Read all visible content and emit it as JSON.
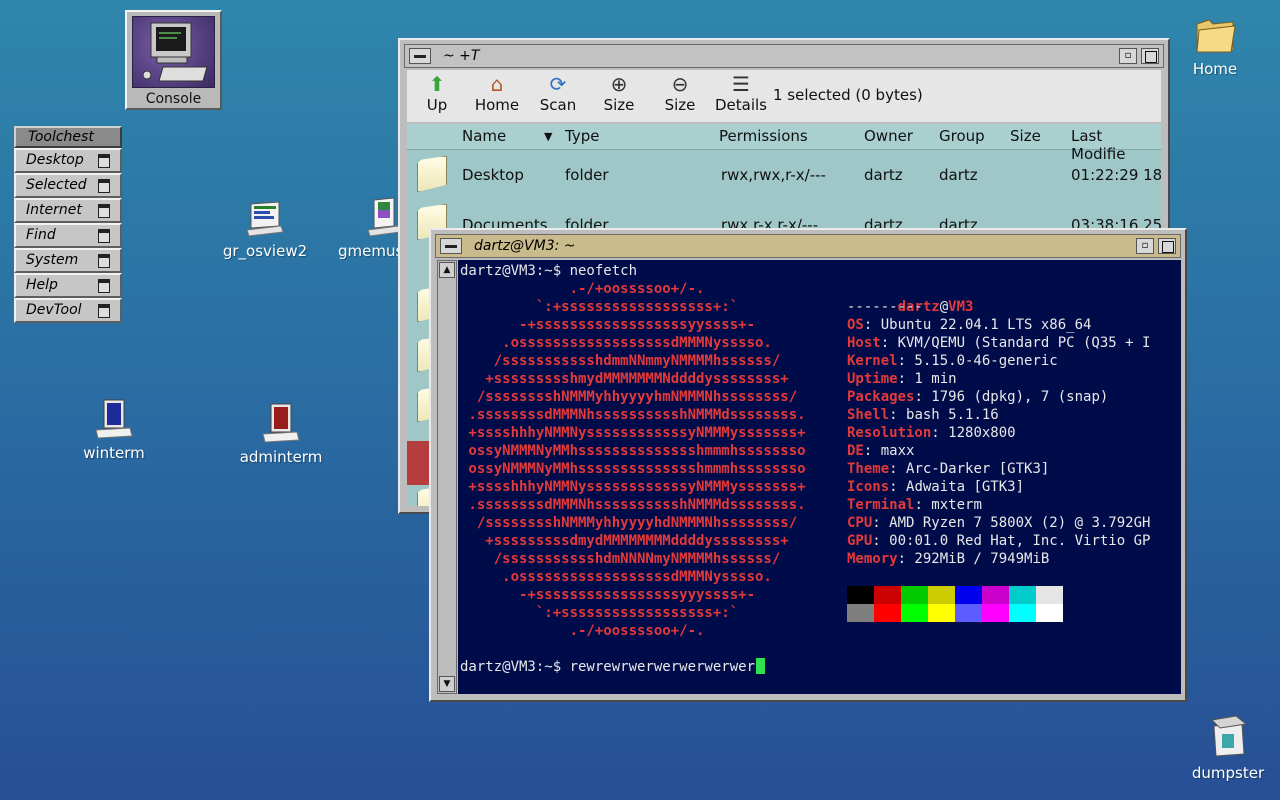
{
  "desktop": {
    "console_label": "Console",
    "home_label": "Home",
    "icons": [
      {
        "label": "gr_osview2"
      },
      {
        "label": "gmemus"
      },
      {
        "label": "winterm"
      },
      {
        "label": "adminterm"
      },
      {
        "label": "dumpster"
      }
    ]
  },
  "toolchest": {
    "title": "Toolchest",
    "items": [
      "Desktop",
      "Selected",
      "Internet",
      "Find",
      "System",
      "Help",
      "DevTool"
    ]
  },
  "filemanager": {
    "title": "~ +T",
    "toolbar": {
      "buttons": [
        {
          "label": "Up",
          "icon": "up-arrow-icon"
        },
        {
          "label": "Home",
          "icon": "home-icon"
        },
        {
          "label": "Scan",
          "icon": "refresh-icon"
        },
        {
          "label": "Size",
          "icon": "zoom-in-icon"
        },
        {
          "label": "Size",
          "icon": "zoom-out-icon"
        },
        {
          "label": "Details",
          "icon": "details-icon"
        }
      ],
      "status": "1 selected (0 bytes)"
    },
    "columns": [
      "Name",
      "Type",
      "Permissions",
      "Owner",
      "Group",
      "Size",
      "Last Modifie"
    ],
    "rows": [
      {
        "name": "Desktop",
        "type": "folder",
        "permissions": "rwx,rwx,r-x/---",
        "owner": "dartz",
        "group": "dartz",
        "modified": "01:22:29 18"
      },
      {
        "name": "Documents",
        "type": "folder",
        "permissions": "rwx,r-x,r-x/---",
        "owner": "dartz",
        "group": "dartz",
        "modified": "03:38:16 25"
      }
    ]
  },
  "terminal": {
    "title": "dartz@VM3: ~",
    "prompt_line": "dartz@VM3:~$ neofetch",
    "logo": [
      "             .-/+oossssoo+/-.",
      "         `:+ssssssssssssssssss+:`",
      "       -+ssssssssssssssssssyyssss+-",
      "     .ossssssssssssssssssdMMMNysssso.",
      "    /ssssssssssshdmmNNmmyNMMMMhssssss/",
      "   +ssssssssshmydMMMMMMMNddddyssssssss+",
      "  /sssssssshNMMMyhhyyyyhmNMMMNhssssssss/",
      " .ssssssssdMMMNhsssssssssshNMMMdssssssss.",
      " +sssshhhyNMMNyssssssssssssyNMMMysssssss+",
      " ossyNMMMNyMMhsssssssssssssshmmmhssssssso",
      " ossyNMMMNyMMhsssssssssssssshmmmhssssssso",
      " +sssshhhyNMMNyssssssssssssyNMMMysssssss+",
      " .ssssssssdMMMNhsssssssssshNMMMdssssssss.",
      "  /sssssssshNMMMyhhyyyyhdNMMMNhssssssss/",
      "   +sssssssssdmydMMMMMMMMddddyssssssss+",
      "    /ssssssssssshdmNNNNmyNMMMMhssssss/",
      "     .ossssssssssssssssssdMMMNysssso.",
      "       -+sssssssssssssssssyyyssss+-",
      "         `:+ssssssssssssssssss+:`",
      "             .-/+oossssoo+/-."
    ],
    "user": "dartz",
    "at": "@",
    "host": "VM3",
    "separator": "---------",
    "info": [
      {
        "key": "OS",
        "value": "Ubuntu 22.04.1 LTS x86_64"
      },
      {
        "key": "Host",
        "value": "KVM/QEMU (Standard PC (Q35 + I"
      },
      {
        "key": "Kernel",
        "value": "5.15.0-46-generic"
      },
      {
        "key": "Uptime",
        "value": "1 min"
      },
      {
        "key": "Packages",
        "value": "1796 (dpkg), 7 (snap)"
      },
      {
        "key": "Shell",
        "value": "bash 5.1.16"
      },
      {
        "key": "Resolution",
        "value": "1280x800"
      },
      {
        "key": "DE",
        "value": "maxx"
      },
      {
        "key": "Theme",
        "value": "Arc-Darker [GTK3]"
      },
      {
        "key": "Icons",
        "value": "Adwaita [GTK3]"
      },
      {
        "key": "Terminal",
        "value": "mxterm"
      },
      {
        "key": "CPU",
        "value": "AMD Ryzen 7 5800X (2) @ 3.792GH"
      },
      {
        "key": "GPU",
        "value": "00:01.0 Red Hat, Inc. Virtio GP"
      },
      {
        "key": "Memory",
        "value": "292MiB / 7949MiB"
      }
    ],
    "palette_dark": [
      "#000000",
      "#cc0000",
      "#00cc00",
      "#cccc00",
      "#0000ee",
      "#cc00cc",
      "#00cccc",
      "#e5e5e5"
    ],
    "palette_bright": [
      "#7f7f7f",
      "#ff0000",
      "#00ff00",
      "#ffff00",
      "#5c5cff",
      "#ff00ff",
      "#00ffff",
      "#ffffff"
    ],
    "input_line": "dartz@VM3:~$ rewrewrwerwerwerwerwer"
  }
}
